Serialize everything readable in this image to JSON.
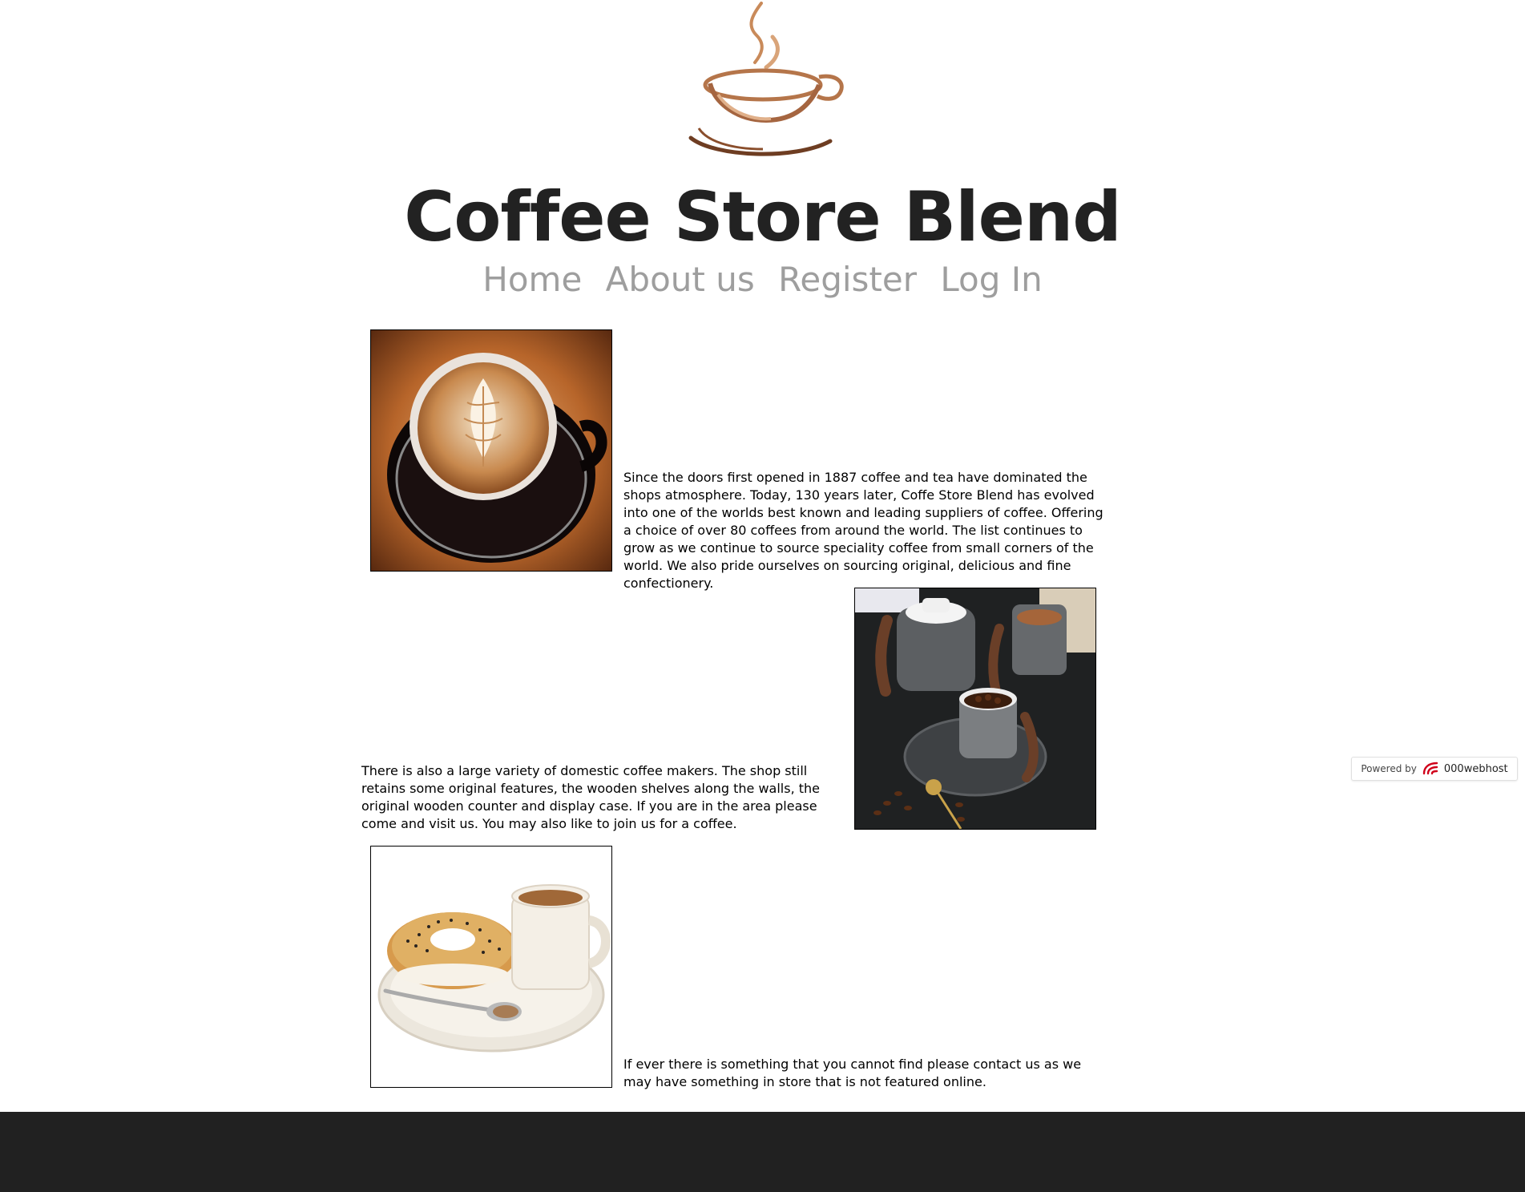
{
  "site": {
    "title": "Coffee Store Blend"
  },
  "nav": {
    "items": [
      {
        "label": "Home"
      },
      {
        "label": "About us"
      },
      {
        "label": "Register"
      },
      {
        "label": "Log In"
      }
    ]
  },
  "sections": [
    {
      "text": "Since the doors first opened in 1887 coffee and tea have dominated the shops atmosphere. Today, 130 years later, Coffe Store Blend has evolved into one of the worlds best known and leading suppliers of coffee. Offering a choice of over 80 coffees from around the world. The list continues to grow as we continue to source speciality coffee from small corners of the world. We also pride ourselves on sourcing original, delicious and fine confectionery."
    },
    {
      "text": "There is also a large variety of domestic coffee makers. The shop still retains some original features, the wooden shelves along the walls, the original wooden counter and display case. If you are in the area please come and visit us. You may also like to join us for a coffee."
    },
    {
      "text": "If ever there is something that you cannot find please contact us as we may have something in store that is not featured online."
    }
  ],
  "badge": {
    "prefix": "Powered by",
    "brand": "000webhost"
  },
  "colors": {
    "nav_text": "#9e9e9e",
    "title_text": "#222222",
    "footer_bg": "#212121"
  }
}
